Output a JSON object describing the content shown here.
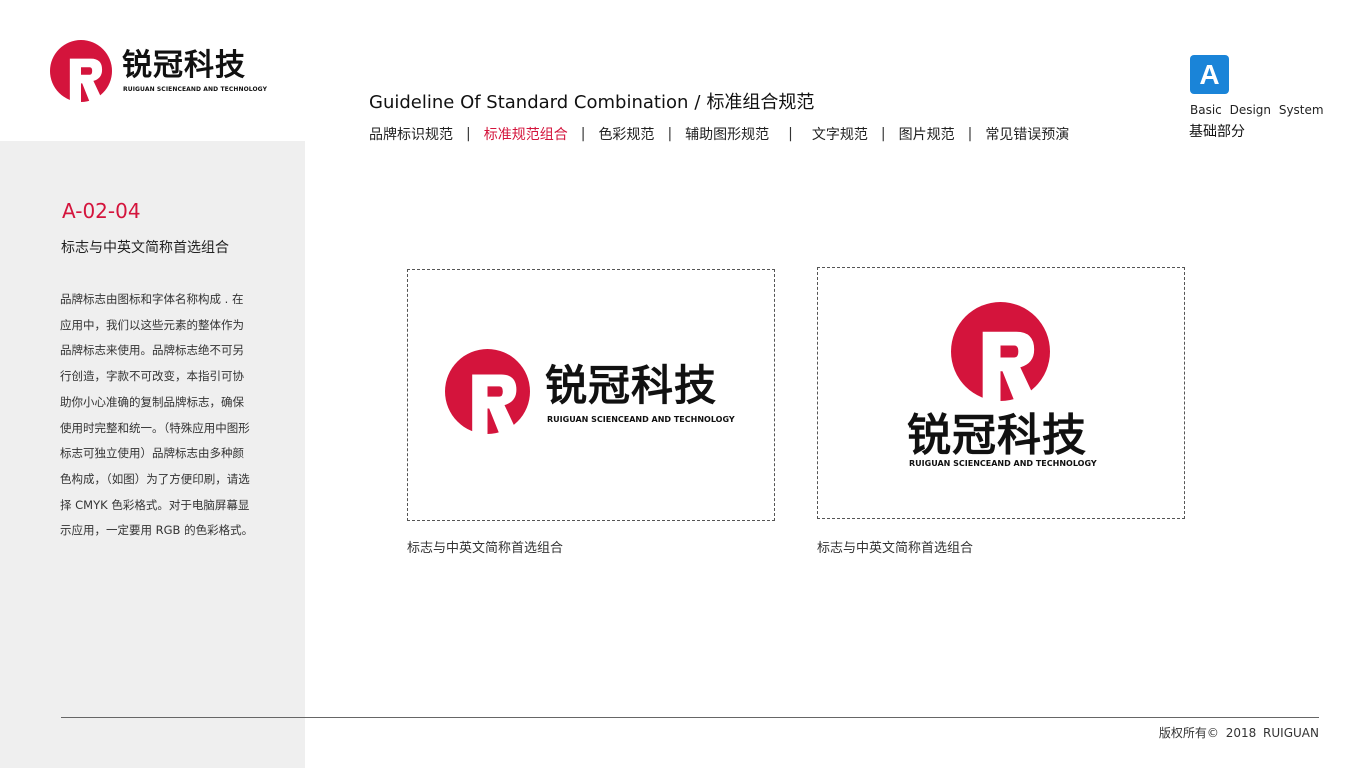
{
  "brand": {
    "name_cn": "锐冠科技",
    "name_en": "RUIGUAN SCIENCEAND AND TECHNOLOGY",
    "primary_color": "#d4143c",
    "mark_letter": "R"
  },
  "header": {
    "title_en": "Guideline Of Standard Combination",
    "title_sep": "/",
    "title_cn": "标准组合规范"
  },
  "nav": {
    "items": [
      {
        "label": "品牌标识规范",
        "active": false
      },
      {
        "label": "标准规范组合",
        "active": true
      },
      {
        "label": "色彩规范",
        "active": false
      },
      {
        "label": "辅助图形规范",
        "active": false
      },
      {
        "label": "文字规范",
        "active": false
      },
      {
        "label": "图片规范",
        "active": false
      },
      {
        "label": "常见错误预演",
        "active": false
      }
    ],
    "separator": "|"
  },
  "section": {
    "letter": "A",
    "badge_color": "#1a84d8",
    "title_en": "Basic Design System",
    "title_cn": "基础部分"
  },
  "page": {
    "code": "A-02-04",
    "subtitle": "标志与中英文简称首选组合",
    "description": [
      "品牌标志由图标和字体名称构成 . 在",
      "应用中，我们以这些元素的整体作为",
      "品牌标志来使用。品牌标志绝不可另",
      "行创造，字款不可改变，本指引可协",
      "助你小心准确的复制品牌标志，确保",
      "使用时完整和统一。（特殊应用中图形",
      "标志可独立使用）品牌标志由多种颜",
      "色构成，（如图）为了方便印刷，请选",
      "择 CMYK 色彩格式。对于电脑屏幕显",
      "示应用，一定要用 RGB 的色彩格式。"
    ]
  },
  "panels": [
    {
      "caption": "标志与中英文简称首选组合",
      "layout": "horizontal"
    },
    {
      "caption": "标志与中英文简称首选组合",
      "layout": "vertical"
    }
  ],
  "footer": {
    "copyright": "版权所有©  2018  RUIGUAN"
  }
}
